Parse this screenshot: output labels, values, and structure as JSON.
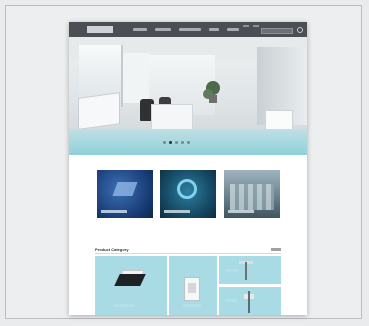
{
  "site": {
    "logo_text": "",
    "section_title": "Product Category"
  },
  "nav": {
    "items": [
      "",
      "",
      "",
      "",
      ""
    ]
  },
  "hero": {
    "slide_count": 5,
    "active_slide": 1
  },
  "categories": [
    {
      "label": ""
    },
    {
      "label": ""
    },
    {
      "label": ""
    }
  ],
  "products": [
    {
      "label": ""
    },
    {
      "label": ""
    },
    {
      "label": ""
    },
    {
      "label": ""
    }
  ],
  "colors": {
    "topbar": "#4b4e52",
    "product_panel": "#a9dbe4",
    "accent_blue": "#173a73"
  }
}
